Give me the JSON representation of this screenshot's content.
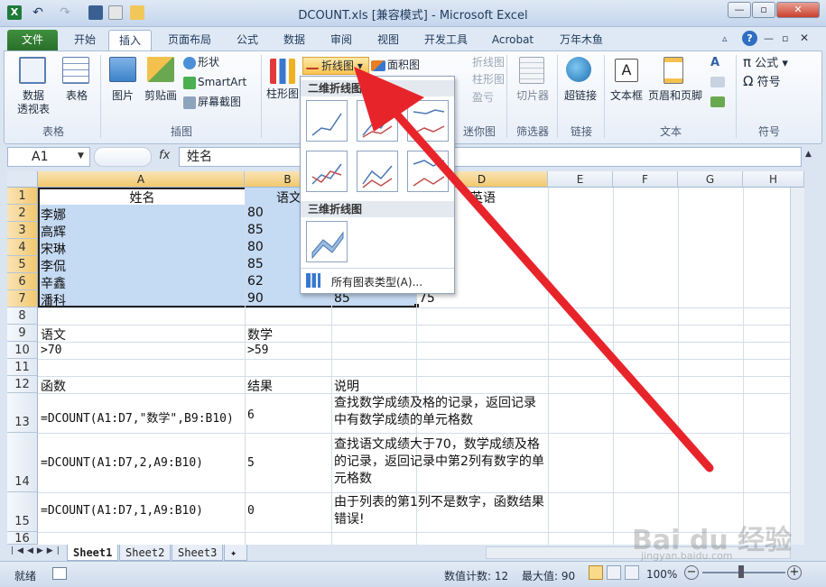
{
  "window": {
    "title": "DCOUNT.xls  [兼容模式] - Microsoft Excel",
    "app_icon": "excel-icon"
  },
  "tabs": [
    "文件",
    "开始",
    "插入",
    "页面布局",
    "公式",
    "数据",
    "审阅",
    "视图",
    "开发工具",
    "Acrobat",
    "万年木鱼"
  ],
  "ribbon": {
    "pivot": "数据\n透视表",
    "table": "表格",
    "picture": "图片",
    "clipart": "剪贴画",
    "shapes": "形状",
    "smartart": "SmartArt",
    "screenshot": "屏幕截图",
    "column_chart": "柱形图",
    "line_chart": "折线图",
    "area_chart": "面积图",
    "spark_line": "折线图",
    "spark_column": "柱形图",
    "spark_winloss": "盈亏",
    "slicer": "切片器",
    "hyperlink": "超链接",
    "textbox": "文本框",
    "headerfooter": "页眉和页脚",
    "formula": "公式",
    "symbol": "符号",
    "groups": {
      "tables": "表格",
      "illustrations": "插图",
      "sparklines": "迷你图",
      "filter": "筛选器",
      "links": "链接",
      "text": "文本",
      "symbols": "符号"
    }
  },
  "formula_bar": {
    "name_box": "A1",
    "fx": "fx",
    "content": "姓名"
  },
  "columns": [
    "A",
    "B",
    "C",
    "D",
    "E",
    "F",
    "G",
    "H"
  ],
  "rows": [
    "1",
    "2",
    "3",
    "4",
    "5",
    "6",
    "7",
    "8",
    "9",
    "10",
    "11",
    "12",
    "13",
    "14",
    "15",
    "16"
  ],
  "cells": {
    "r1": [
      "姓名",
      "语文",
      "",
      "英语"
    ],
    "r2": [
      "李娜",
      "80"
    ],
    "r3": [
      "高辉",
      "85"
    ],
    "r4": [
      "宋琳",
      "80"
    ],
    "r5": [
      "李侃",
      "85"
    ],
    "r6": [
      "辛鑫",
      "62"
    ],
    "r7": [
      "潘科",
      "90",
      "85",
      "75"
    ],
    "r9": [
      "语文",
      "数学"
    ],
    "r10": [
      ">70",
      ">59"
    ],
    "r12": [
      "函数",
      "结果",
      "说明"
    ],
    "r13": [
      "=DCOUNT(A1:D7,\"数学\",B9:B10)",
      "6",
      "查找数学成绩及格的记录，返回记录中有数学成绩的单元格数"
    ],
    "r14": [
      "=DCOUNT(A1:D7,2,A9:B10)",
      "5",
      "查找语文成绩大于70，数学成绩及格的记录，返回记录中第2列有数字的单元格数"
    ],
    "r15": [
      "=DCOUNT(A1:D7,1,A9:B10)",
      "0",
      "由于列表的第1列不是数字，函数结果错误!"
    ]
  },
  "dropdown": {
    "section_2d": "二维折线图",
    "section_3d": "三维折线图",
    "all_types": "所有图表类型(A)..."
  },
  "sheets": [
    "Sheet1",
    "Sheet2",
    "Sheet3"
  ],
  "status": {
    "ready": "就绪",
    "count": "数值计数: 12",
    "max": "最大值: 90",
    "zoom": "100%"
  },
  "watermark": {
    "brand": "Bai du 经验",
    "url": "jingyan.baidu.com"
  },
  "colors": {
    "accent_arrow": "#e8242b",
    "file_tab": "#2a6f2a",
    "selection": "#c5daf3"
  }
}
